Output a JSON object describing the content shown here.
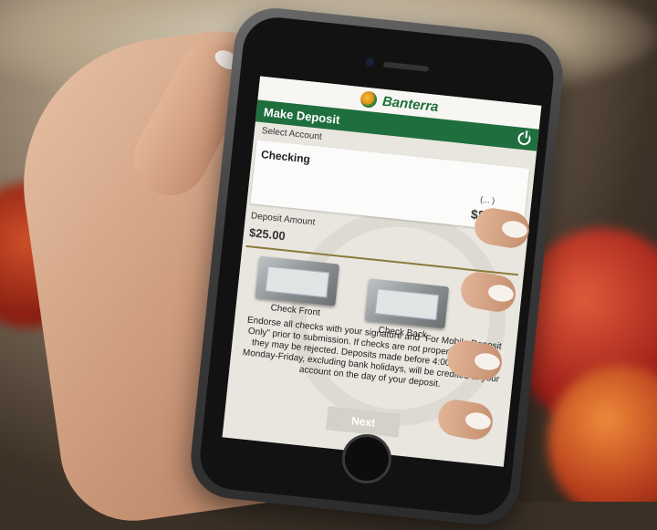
{
  "app": {
    "brand": "Banterra",
    "title": "Make Deposit"
  },
  "account": {
    "select_label": "Select Account",
    "name": "Checking",
    "number": "(...        )",
    "balance": "$883.29"
  },
  "deposit": {
    "amount_label": "Deposit Amount",
    "amount": "$25.00"
  },
  "checks": {
    "front_label": "Check Front",
    "back_label": "Check Back"
  },
  "instructions": "Endorse all checks with your signature and “For Mobile Deposit Only” prior to submission. If checks are not properly endorsed, they may be rejected. Deposits made before 4:00 pm CT on Monday-Friday, excluding bank holidays, will be credited to your account on the day of your deposit.",
  "buttons": {
    "next": "Next"
  },
  "colors": {
    "brand_green": "#1f6e3e"
  }
}
